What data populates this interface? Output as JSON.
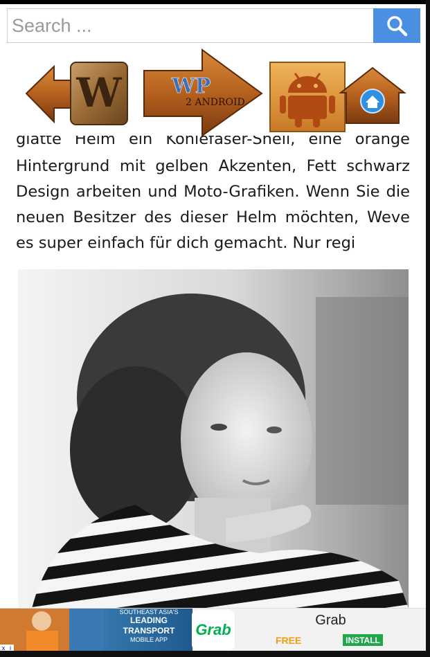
{
  "search": {
    "placeholder": "Search ..."
  },
  "logo": {
    "left_letter": "W",
    "center_main": "WP",
    "center_sub": "2 ANDROID"
  },
  "article": {
    "clipped_line": "glatte Helm ein Kohlefaser-Shell, eine orange",
    "paragraph": "Hintergrund mit gelben Akzenten, Fett schwarz Design arbeiten und Moto-Grafiken. Wenn Sie die neuen Besitzer des dieser Helm möchten, Weve es super einfach für dich gemacht. Nur regi"
  },
  "ad": {
    "tagline_top": "SOUTHEAST ASIA'S",
    "tagline_main": "LEADING TRANSPORT",
    "tagline_sub": "MOBILE APP",
    "logo_text": "Grab",
    "title": "Grab",
    "price": "FREE",
    "install_label": "INSTALL",
    "close_label": "x",
    "info_label": "i"
  },
  "icons": [
    "search-icon",
    "back-arrow-icon",
    "forward-arrow-icon",
    "android-icon",
    "home-icon"
  ],
  "colors": {
    "search_button": "#4a8fe2",
    "install": "#22a64a",
    "wood": "#b5651d",
    "grab_green": "#00b14f"
  }
}
